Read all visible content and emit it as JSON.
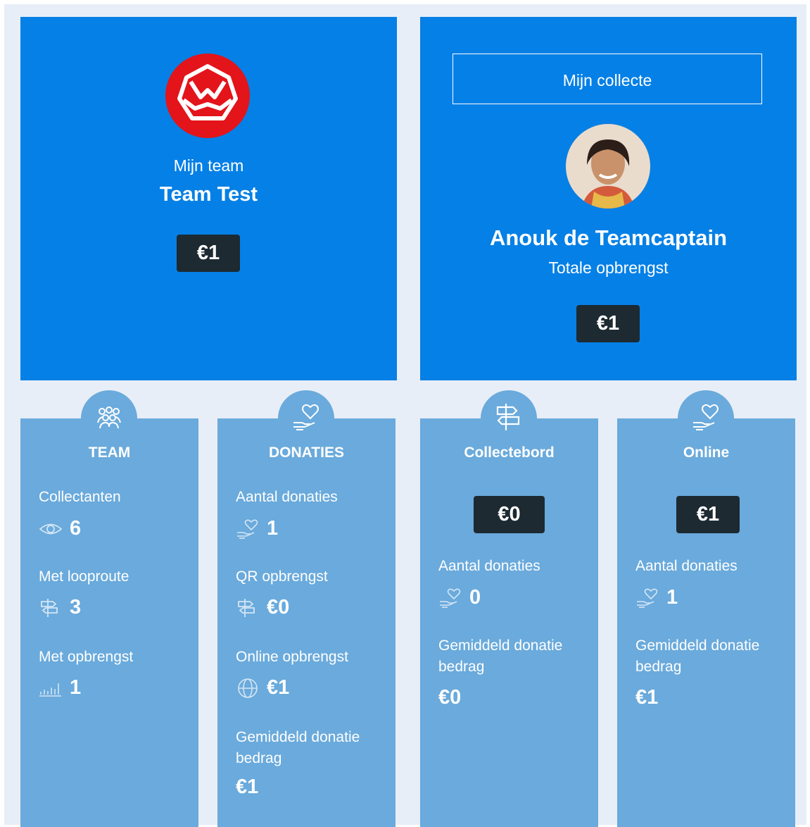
{
  "team": {
    "label": "Mijn team",
    "name": "Team Test",
    "amount": "€1"
  },
  "captain": {
    "button_label": "Mijn collecte",
    "name": "Anouk de Teamcaptain",
    "subtitle": "Totale opbrengst",
    "amount": "€1"
  },
  "cards": {
    "team": {
      "title": "TEAM",
      "collectanten_label": "Collectanten",
      "collectanten_value": "6",
      "looproute_label": "Met looproute",
      "looproute_value": "3",
      "opbrengst_label": "Met opbrengst",
      "opbrengst_value": "1"
    },
    "donaties": {
      "title": "DONATIES",
      "aantal_label": "Aantal donaties",
      "aantal_value": "1",
      "qr_label": "QR opbrengst",
      "qr_value": "€0",
      "online_label": "Online opbrengst",
      "online_value": "€1",
      "gem_label_1": "Gemiddeld donatie",
      "gem_label_2": "bedrag",
      "gem_value": "€1"
    },
    "collectebord": {
      "title": "Collectebord",
      "amount": "€0",
      "aantal_label": "Aantal donaties",
      "aantal_value": "0",
      "gem_label_1": "Gemiddeld donatie",
      "gem_label_2": "bedrag",
      "gem_value": "€0"
    },
    "online": {
      "title": "Online",
      "amount": "€1",
      "aantal_label": "Aantal donaties",
      "aantal_value": "1",
      "gem_label_1": "Gemiddeld donatie",
      "gem_label_2": "bedrag",
      "gem_value": "€1"
    }
  },
  "colors": {
    "primary_blue": "#0580e6",
    "card_blue": "#6aaadc",
    "badge_dark": "#1d2a32",
    "logo_red": "#e3141a",
    "background": "#e8eef7"
  }
}
